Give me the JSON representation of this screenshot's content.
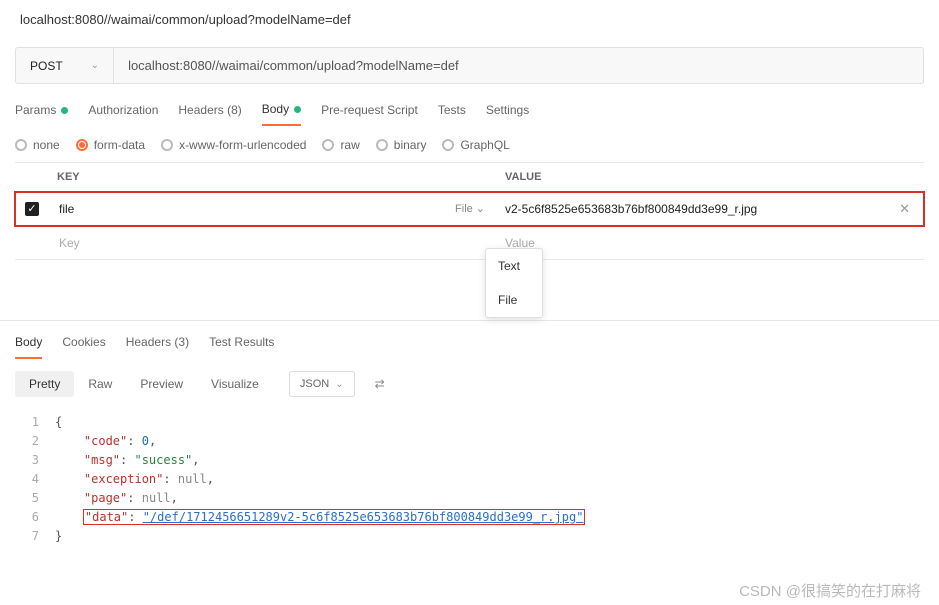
{
  "top_url": "localhost:8080//waimai/common/upload?modelName=def",
  "request": {
    "method": "POST",
    "url": "localhost:8080//waimai/common/upload?modelName=def"
  },
  "tabs": {
    "params": "Params",
    "authorization": "Authorization",
    "headers": "Headers (8)",
    "body": "Body",
    "prerequest": "Pre-request Script",
    "tests": "Tests",
    "settings": "Settings"
  },
  "body_options": {
    "none": "none",
    "formdata": "form-data",
    "xwww": "x-www-form-urlencoded",
    "raw": "raw",
    "binary": "binary",
    "graphql": "GraphQL"
  },
  "table": {
    "key_header": "KEY",
    "value_header": "VALUE",
    "row1": {
      "key": "file",
      "type": "File",
      "value": "v2-5c6f8525e653683b76bf800849dd3e99_r.jpg"
    },
    "key_placeholder": "Key",
    "value_placeholder": "Value"
  },
  "type_dropdown": {
    "text": "Text",
    "file": "File"
  },
  "response": {
    "tabs": {
      "body": "Body",
      "cookies": "Cookies",
      "headers": "Headers (3)",
      "tests": "Test Results"
    },
    "views": {
      "pretty": "Pretty",
      "raw": "Raw",
      "preview": "Preview",
      "visualize": "Visualize"
    },
    "format": "JSON",
    "json": {
      "l1": "{",
      "l2_key": "\"code\"",
      "l2_val": "0",
      "l3_key": "\"msg\"",
      "l3_val": "\"sucess\"",
      "l4_key": "\"exception\"",
      "l4_val": "null",
      "l5_key": "\"page\"",
      "l5_val": "null",
      "l6_key": "\"data\"",
      "l6_val": "\"/def/1712456651289v2-5c6f8525e653683b76bf800849dd3e99_r.jpg\"",
      "l7": "}"
    }
  },
  "line_numbers": [
    "1",
    "2",
    "3",
    "4",
    "5",
    "6",
    "7"
  ],
  "watermark": "CSDN @很搞笑的在打麻将"
}
